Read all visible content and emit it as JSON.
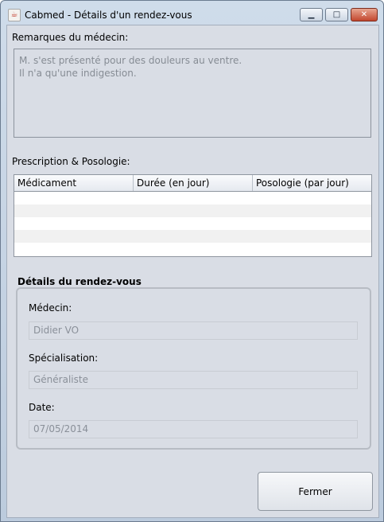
{
  "window": {
    "title": "Cabmed - Détails d'un rendez-vous",
    "minimize_glyph": "▁",
    "maximize_glyph": "□",
    "close_glyph": "✕"
  },
  "remarks": {
    "label": "Remarques du médecin:",
    "lines": [
      "M. s'est présenté pour des douleurs au ventre.",
      "Il n'a qu'une indigestion."
    ]
  },
  "prescription": {
    "label": "Prescription & Posologie:",
    "columns": [
      "Médicament",
      "Durée (en jour)",
      "Posologie (par jour)"
    ],
    "rows": []
  },
  "details": {
    "title": "Détails du rendez-vous",
    "doctor_label": "Médecin:",
    "doctor_value": "Didier VO",
    "specialty_label": "Spécialisation:",
    "specialty_value": "Généraliste",
    "date_label": "Date:",
    "date_value": "07/05/2014"
  },
  "actions": {
    "close_label": "Fermer"
  },
  "icons": {
    "app": "java-cup-icon"
  }
}
